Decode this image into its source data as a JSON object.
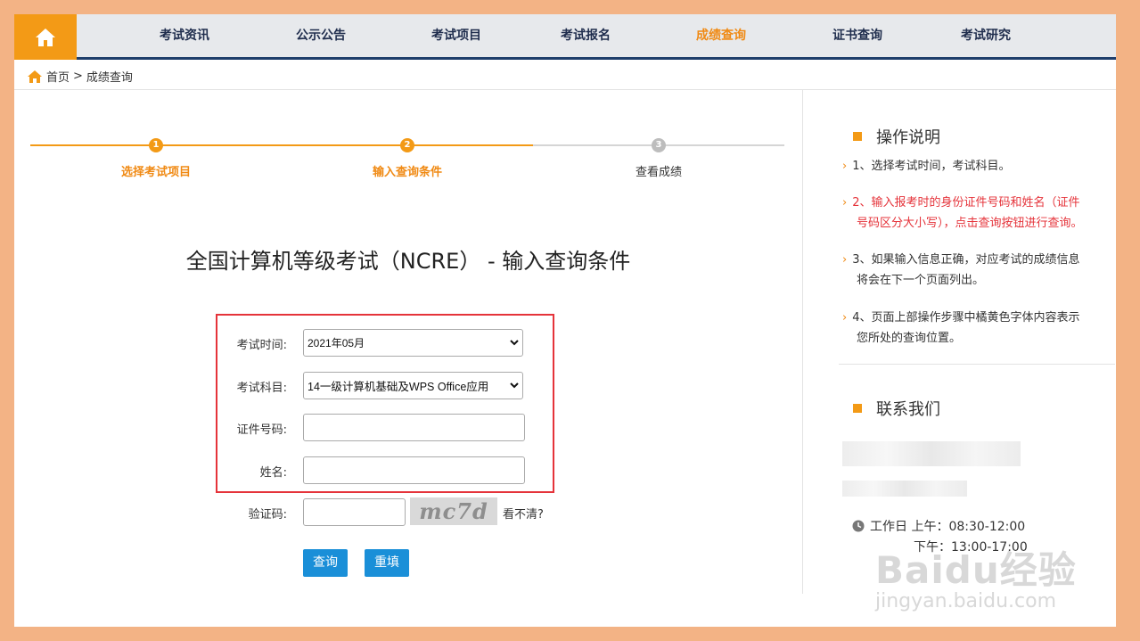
{
  "nav": {
    "items": [
      {
        "label": "考试资讯",
        "active": false
      },
      {
        "label": "公示公告",
        "active": false
      },
      {
        "label": "考试项目",
        "active": false
      },
      {
        "label": "考试报名",
        "active": false
      },
      {
        "label": "成绩查询",
        "active": true
      },
      {
        "label": "证书查询",
        "active": false
      },
      {
        "label": "考试研究",
        "active": false
      }
    ]
  },
  "breadcrumb": {
    "home": "首页",
    "separator": ">",
    "current": "成绩查询"
  },
  "steps": [
    {
      "num": "1",
      "label": "选择考试项目",
      "state": "done"
    },
    {
      "num": "2",
      "label": "输入查询条件",
      "state": "current"
    },
    {
      "num": "3",
      "label": "查看成绩",
      "state": "pending"
    }
  ],
  "form": {
    "title": "全国计算机等级考试（NCRE） - 输入查询条件",
    "exam_time_label": "考试时间:",
    "exam_time_value": "2021年05月",
    "subject_label": "考试科目:",
    "subject_value": "14一级计算机基础及WPS Office应用",
    "id_label": "证件号码:",
    "id_value": "",
    "name_label": "姓名:",
    "name_value": "",
    "captcha_label": "验证码:",
    "captcha_value": "",
    "captcha_text": "mc7d",
    "captcha_refresh": "看不清?",
    "submit": "查询",
    "reset": "重填"
  },
  "sidebar": {
    "instructions_title": "操作说明",
    "notes": [
      {
        "text": "1、选择考试时间，考试科目。",
        "highlight": false
      },
      {
        "line1": "2、输入报考时的身份证件号码和姓名（证件",
        "line2": "号码区分大小写），点击查询按钮进行查询。",
        "highlight": true
      },
      {
        "line1": "3、如果输入信息正确，对应考试的成绩信息",
        "line2": "将会在下一个页面列出。",
        "highlight": false
      },
      {
        "line1": "4、页面上部操作步骤中橘黄色字体内容表示",
        "line2": "您所处的查询位置。",
        "highlight": false
      }
    ],
    "contact_title": "联系我们",
    "hours_line1": "工作日 上午：08:30-12:00",
    "hours_line2": "下午：13:00-17:00"
  },
  "watermark": {
    "brand": "Baidu经验",
    "url": "jingyan.baidu.com"
  },
  "colors": {
    "accent": "#F08A14",
    "nav_border": "#1E3E6B",
    "button": "#1A8FD8",
    "highlight": "#E5333A",
    "frame": "#F3B385"
  }
}
